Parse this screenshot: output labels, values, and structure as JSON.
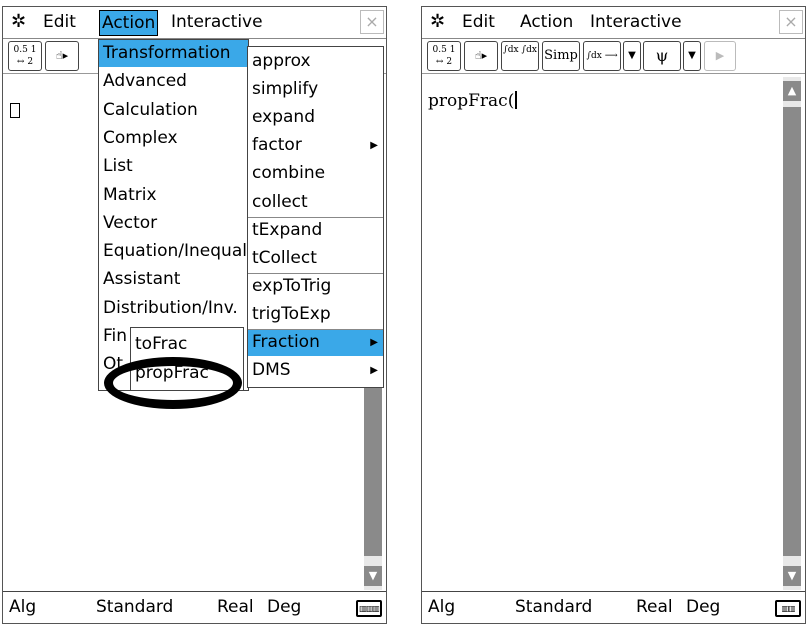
{
  "screen1": {
    "menubar": {
      "gear": "✲",
      "edit": "Edit",
      "action": "Action",
      "interactive": "Interactive",
      "close": "×"
    },
    "toolbar": {
      "frac_conv": "0.5 1 ↔ 2",
      "pointer": "☝▸"
    },
    "action_menu": [
      "Transformation",
      "Advanced",
      "Calculation",
      "Complex",
      "List",
      "Matrix",
      "Vector",
      "Equation/Inequali",
      "Assistant",
      "Distribution/Inv.",
      "Fin",
      "Ot"
    ],
    "transformation_menu": [
      "approx",
      "simplify",
      "expand",
      "factor",
      "combine",
      "collect",
      "tExpand",
      "tCollect",
      "expToTrig",
      "trigToExp",
      "Fraction",
      "DMS"
    ],
    "fraction_menu": [
      "toFrac",
      "propFrac"
    ],
    "status": {
      "alg": "Alg",
      "std": "Standard",
      "real": "Real",
      "deg": "Deg",
      "battery": "▥▥▥"
    }
  },
  "screen2": {
    "menubar": {
      "gear": "✲",
      "edit": "Edit",
      "action": "Action",
      "interactive": "Interactive",
      "close": "×"
    },
    "toolbar": {
      "frac_conv": "0.5 1 ↔ 2",
      "pointer": "☝▸",
      "integrate": "∫dx ∫dx",
      "simp": "Simp",
      "dx_btn": "∫dx ⟶",
      "down1": "▼",
      "graph": "ψ",
      "down2": "▼",
      "play": "▶"
    },
    "input": "propFrac(",
    "status": {
      "alg": "Alg",
      "std": "Standard",
      "real": "Real",
      "deg": "Deg",
      "battery": "▥▥"
    }
  },
  "colors": {
    "highlight": "#3aa8e8",
    "scroll": "#8a8a8a"
  }
}
